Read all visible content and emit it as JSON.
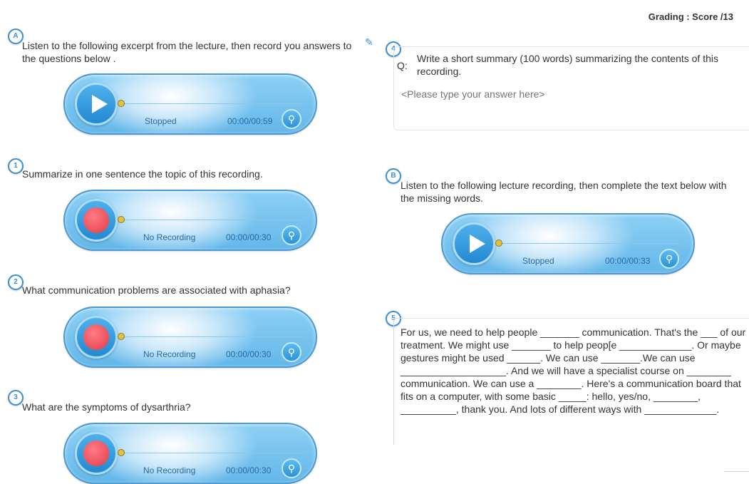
{
  "header": {
    "grading": "Grading : Score /13"
  },
  "sectionA": {
    "badge": "A",
    "instruction": "Listen to the following excerpt from the lecture, then record you answers to the questions below .",
    "player": {
      "status": "Stopped",
      "time": "00:00/00:59"
    }
  },
  "questions": [
    {
      "badge": "1",
      "text": "Summarize in one sentence the topic of this recording.",
      "status": "No Recording",
      "time": "00:00/00:30"
    },
    {
      "badge": "2",
      "text": "What communication problems are associated with aphasia?",
      "status": "No Recording",
      "time": "00:00/00:30"
    },
    {
      "badge": "3",
      "text": "What are the symptoms of dysarthria?",
      "status": "No Recording",
      "time": "00:00/00:30"
    }
  ],
  "question4": {
    "badge": "4",
    "q_label": "Q:",
    "prompt": "Write a short summary (100 words) summarizing the contents of this recording.",
    "placeholder": "<Please type your answer here>"
  },
  "sectionB": {
    "badge": "B",
    "instruction": "Listen to the following lecture recording, then complete the text below with the missing words.",
    "player": {
      "status": "Stopped",
      "time": "00:00/00:33"
    }
  },
  "question5": {
    "badge": "5",
    "text": "For us, we need to help people _______ communication. That's the ___ of our treatment. We might use _______ to help peop[e _____________. Or maybe gestures might be used ______. We can use _______.We can use ___________________. And we will have a specialist course on ________ communication. We can use a ________.  Here's a communication board that fits on a computer, with some basic _____: hello, yes/no, ________, __________, thank you. And lots of different ways with _____________."
  }
}
